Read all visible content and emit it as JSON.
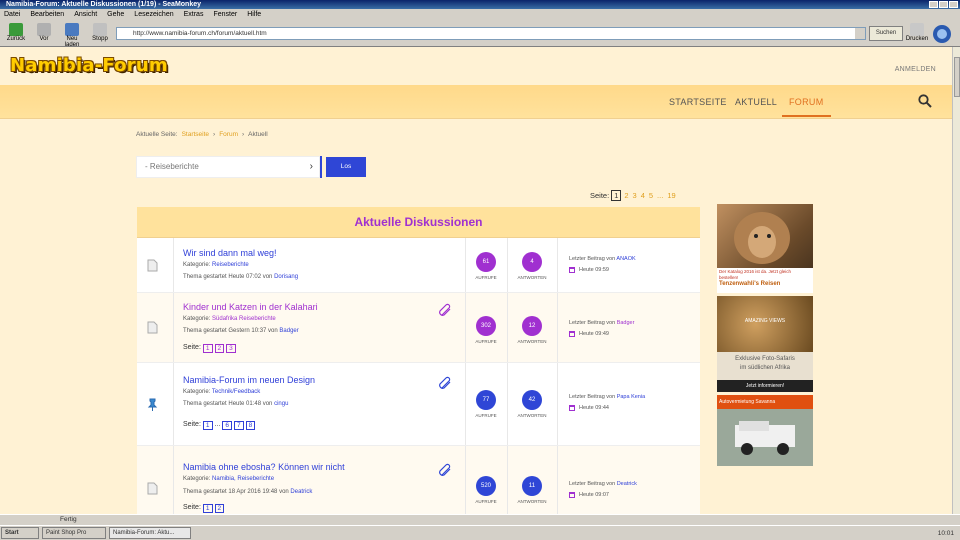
{
  "window": {
    "title": "Namibia-Forum: Aktuelle Diskussionen (1/19) - SeaMonkey"
  },
  "menu": [
    "Datei",
    "Bearbeiten",
    "Ansicht",
    "Gehe",
    "Lesezeichen",
    "Extras",
    "Fenster",
    "Hilfe"
  ],
  "toolbar": {
    "back": "Zurück",
    "forward": "Vor",
    "reload": "Neu laden",
    "stop": "Stopp",
    "url": "http://www.namibia-forum.ch/forum/aktuell.htm",
    "search": "Suchen",
    "print": "Drucken"
  },
  "site": {
    "logo": "Namibia-Forum",
    "login": "ANMELDEN",
    "nav": [
      "STARTSEITE",
      "AKTUELL",
      "FORUM"
    ]
  },
  "breadcrumb": {
    "label": "Aktuelle Seite:",
    "items": [
      "Startseite",
      "Forum",
      "Aktuell"
    ]
  },
  "filter": {
    "selected": "- Reiseberichte",
    "go": "Los"
  },
  "pager": {
    "label": "Seite:",
    "pages": [
      "1",
      "2",
      "3",
      "4",
      "5",
      "...",
      "19"
    ],
    "current": "1"
  },
  "board": {
    "title": "Aktuelle Diskussionen"
  },
  "labels": {
    "answers": "AUFRUFE",
    "replies": "ANTWORTEN",
    "last_prefix": "Letzter Beitrag von"
  },
  "threads": [
    {
      "title": "Wir sind dann mal weg!",
      "cat_label": "Kategorie:",
      "category": "Reiseberichte",
      "meta_prefix": "Thema gestartet Heute 07:02 von",
      "author": "Dorisang",
      "pages": [],
      "views": "61",
      "replies": "4",
      "last_by": "ANAOK",
      "last_time": "Heute 09:59",
      "color": "#a030d0"
    },
    {
      "title": "Kinder und Katzen in der Kalahari",
      "cat_label": "Kategorie:",
      "category": "Südafrika Reiseberichte",
      "meta_prefix": "Thema gestartet Gestern 10:37 von",
      "author": "Badger",
      "pages": [
        "1",
        "2",
        "3"
      ],
      "views": "302",
      "replies": "12",
      "last_by": "Badger",
      "last_time": "Heute 09:49",
      "color": "#a030d0"
    },
    {
      "title": "Namibia-Forum im neuen Design",
      "cat_label": "Kategorie:",
      "category": "Technik/Feedback",
      "meta_prefix": "Thema gestartet Heute 01:48 von",
      "author": "cingu",
      "pages": [
        "1",
        "...",
        "6",
        "7",
        "8"
      ],
      "views": "77",
      "replies": "42",
      "last_by": "Papa Kenia",
      "last_time": "Heute 09:44",
      "color": "#2f46d6"
    },
    {
      "title": "Namibia ohne ebosha? Können wir nicht",
      "cat_label": "Kategorie:",
      "category": "Namibia, Reiseberichte",
      "meta_prefix": "Thema gestartet 18 Apr 2016 19:48 von",
      "author": "Deatrick",
      "pages": [
        "1",
        "2"
      ],
      "views": "520",
      "replies": "11",
      "last_by": "Deatrick",
      "last_time": "Heute 09:07",
      "color": "#2f46d6"
    }
  ],
  "ads": [
    {
      "line1": "Der Katalog 2016 ist da. Jetzt gleich bestellen!",
      "brand": "Tenzenwahli's Reisen"
    },
    {
      "line1": "AMAZING VIEWS",
      "line2": "Exklusive Foto-Safaris",
      "line3": "im südlichen Afrika",
      "cta": "Jetzt informieren!"
    },
    {
      "line1": "Autovermietung Savanna"
    }
  ],
  "status": {
    "text": "Fertig"
  },
  "taskbar": {
    "start": "Start",
    "tasks": [
      "Paint Shop Pro",
      "Namibia-Forum: Aktu..."
    ],
    "clock": "10:01"
  }
}
